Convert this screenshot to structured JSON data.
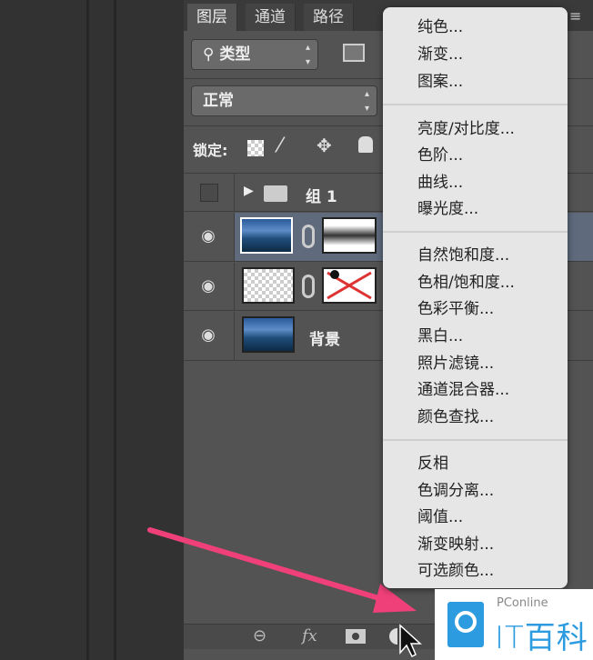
{
  "tabs": [
    "图层",
    "通道",
    "路径"
  ],
  "filter": {
    "label": "类型",
    "icon": "search-icon"
  },
  "blend_mode": "正常",
  "lock_label": "锁定:",
  "layers": [
    {
      "name": "组 1",
      "type": "group"
    },
    {
      "name": "",
      "type": "adjustment-with-mask",
      "selected": true
    },
    {
      "name": "",
      "type": "transparent-with-mask"
    },
    {
      "name": "背景",
      "type": "background"
    }
  ],
  "menu": {
    "groups": [
      [
        "纯色...",
        "渐变...",
        "图案..."
      ],
      [
        "亮度/对比度...",
        "色阶...",
        "曲线...",
        "曝光度..."
      ],
      [
        "自然饱和度...",
        "色相/饱和度...",
        "色彩平衡...",
        "黑白...",
        "照片滤镜...",
        "通道混合器...",
        "颜色查找..."
      ],
      [
        "反相",
        "色调分离...",
        "阈值...",
        "渐变映射...",
        "可选颜色..."
      ]
    ]
  },
  "bottom_bar": {
    "fx": "fx"
  },
  "watermark": {
    "brand": "PConline",
    "name": "IT百科"
  },
  "colors": {
    "arrow": "#f0407a",
    "menu_bg": "#e6e6e6",
    "panel_bg": "#535353",
    "selected_row": "#5f6b7d"
  }
}
